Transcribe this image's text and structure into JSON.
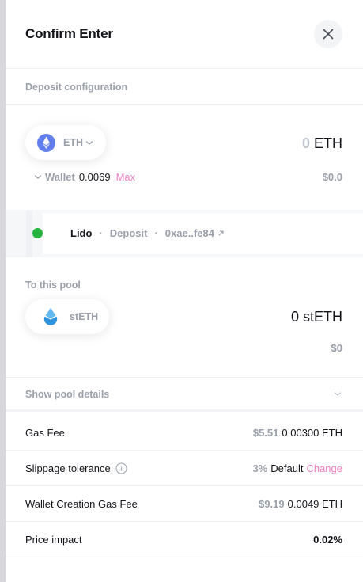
{
  "header": {
    "title": "Confirm Enter"
  },
  "deposit": {
    "section_label": "Deposit configuration",
    "token_symbol": "ETH",
    "amount_zero": "0",
    "amount_unit": "ETH",
    "wallet_label": "Wallet",
    "wallet_balance": "0.0069",
    "max_label": "Max",
    "usd_value": "$0.0"
  },
  "route": {
    "protocol": "Lido",
    "action": "Deposit",
    "address": "0xae..fe84",
    "status_color": "#27b33f"
  },
  "pool": {
    "section_label": "To this pool",
    "token_symbol": "stETH",
    "amount": "0 stETH",
    "usd_value": "$0"
  },
  "details": {
    "label": "Show pool details"
  },
  "fees": {
    "gas_fee": {
      "label": "Gas Fee",
      "usd": "$5.51",
      "value": "0.00300 ETH"
    },
    "slippage": {
      "label": "Slippage tolerance",
      "percent": "3%",
      "mode": "Default",
      "change_label": "Change"
    },
    "wallet_creation": {
      "label": "Wallet Creation Gas Fee",
      "usd": "$9.19",
      "value": "0.0049 ETH"
    },
    "price_impact": {
      "label": "Price impact",
      "value": "0.02%"
    }
  },
  "colors": {
    "accent_pink": "#f07fc7",
    "eth_purple": "#627eea",
    "steth_blue": "#3ea2e5",
    "muted": "#9aa0ab"
  },
  "icons": [
    "close-icon",
    "eth-logo-icon",
    "chevron-down-icon",
    "external-link-icon",
    "steth-logo-icon",
    "info-icon"
  ]
}
